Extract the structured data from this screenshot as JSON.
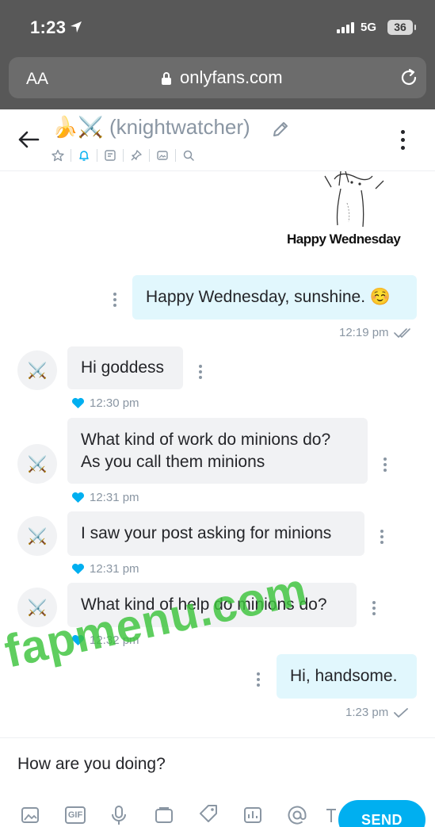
{
  "status_bar": {
    "time": "1:23",
    "network": "5G",
    "battery": "36"
  },
  "browser": {
    "text_size_label": "AA",
    "url": "onlyfans.com"
  },
  "chat": {
    "name": "🍌⚔️ (knightwatcher)"
  },
  "sticker": {
    "text": "Happy Wednesday"
  },
  "messages": [
    {
      "direction": "out",
      "text": "Happy Wednesday, sunshine. ☺️",
      "time": "12:19 pm",
      "status": "read"
    },
    {
      "direction": "in",
      "text": "Hi goddess",
      "time": "12:30 pm",
      "liked": true
    },
    {
      "direction": "in",
      "line1": "What kind of work do minions do?",
      "line2": "As you call them minions",
      "time": "12:31 pm",
      "liked": true
    },
    {
      "direction": "in",
      "text": "I saw your post asking for minions",
      "time": "12:31 pm",
      "liked": true
    },
    {
      "direction": "in",
      "text": "What kind of help do minions do?",
      "time": "12:32 pm",
      "liked": true
    },
    {
      "direction": "out",
      "text": "Hi, handsome.",
      "time": "1:23 pm",
      "status": "sent"
    }
  ],
  "avatar_glyph": "⚔️",
  "composer": {
    "value": "How are you doing?",
    "send_label": "SEND",
    "gif_label": "GIF"
  },
  "watermark": "fapmenu.com",
  "colors": {
    "accent": "#00aff0",
    "outgoing_bubble": "#e1f7fd",
    "incoming_bubble": "#f1f2f4",
    "meta_gray": "#8a96a3",
    "browser_chrome": "#585858"
  }
}
